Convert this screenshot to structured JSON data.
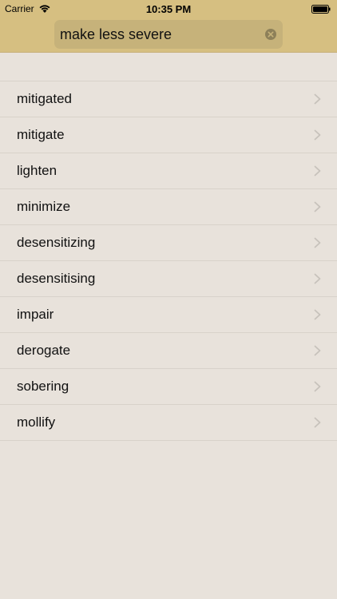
{
  "status_bar": {
    "carrier": "Carrier",
    "time": "10:35 PM"
  },
  "search": {
    "value": "make less severe"
  },
  "results": [
    {
      "label": "mitigated"
    },
    {
      "label": "mitigate"
    },
    {
      "label": "lighten"
    },
    {
      "label": "minimize"
    },
    {
      "label": "desensitizing"
    },
    {
      "label": "desensitising"
    },
    {
      "label": "impair"
    },
    {
      "label": "derogate"
    },
    {
      "label": "sobering"
    },
    {
      "label": "mollify"
    }
  ],
  "colors": {
    "header": "#d6bf81",
    "search_field": "#c6b27a",
    "background": "#e8e2db",
    "separator": "#d8d2ca",
    "chevron": "#c7c2bb"
  },
  "icons": {
    "network": "wifi-icon",
    "power": "battery-icon",
    "clear": "clear-icon",
    "disclosure": "chevron-right-icon"
  }
}
